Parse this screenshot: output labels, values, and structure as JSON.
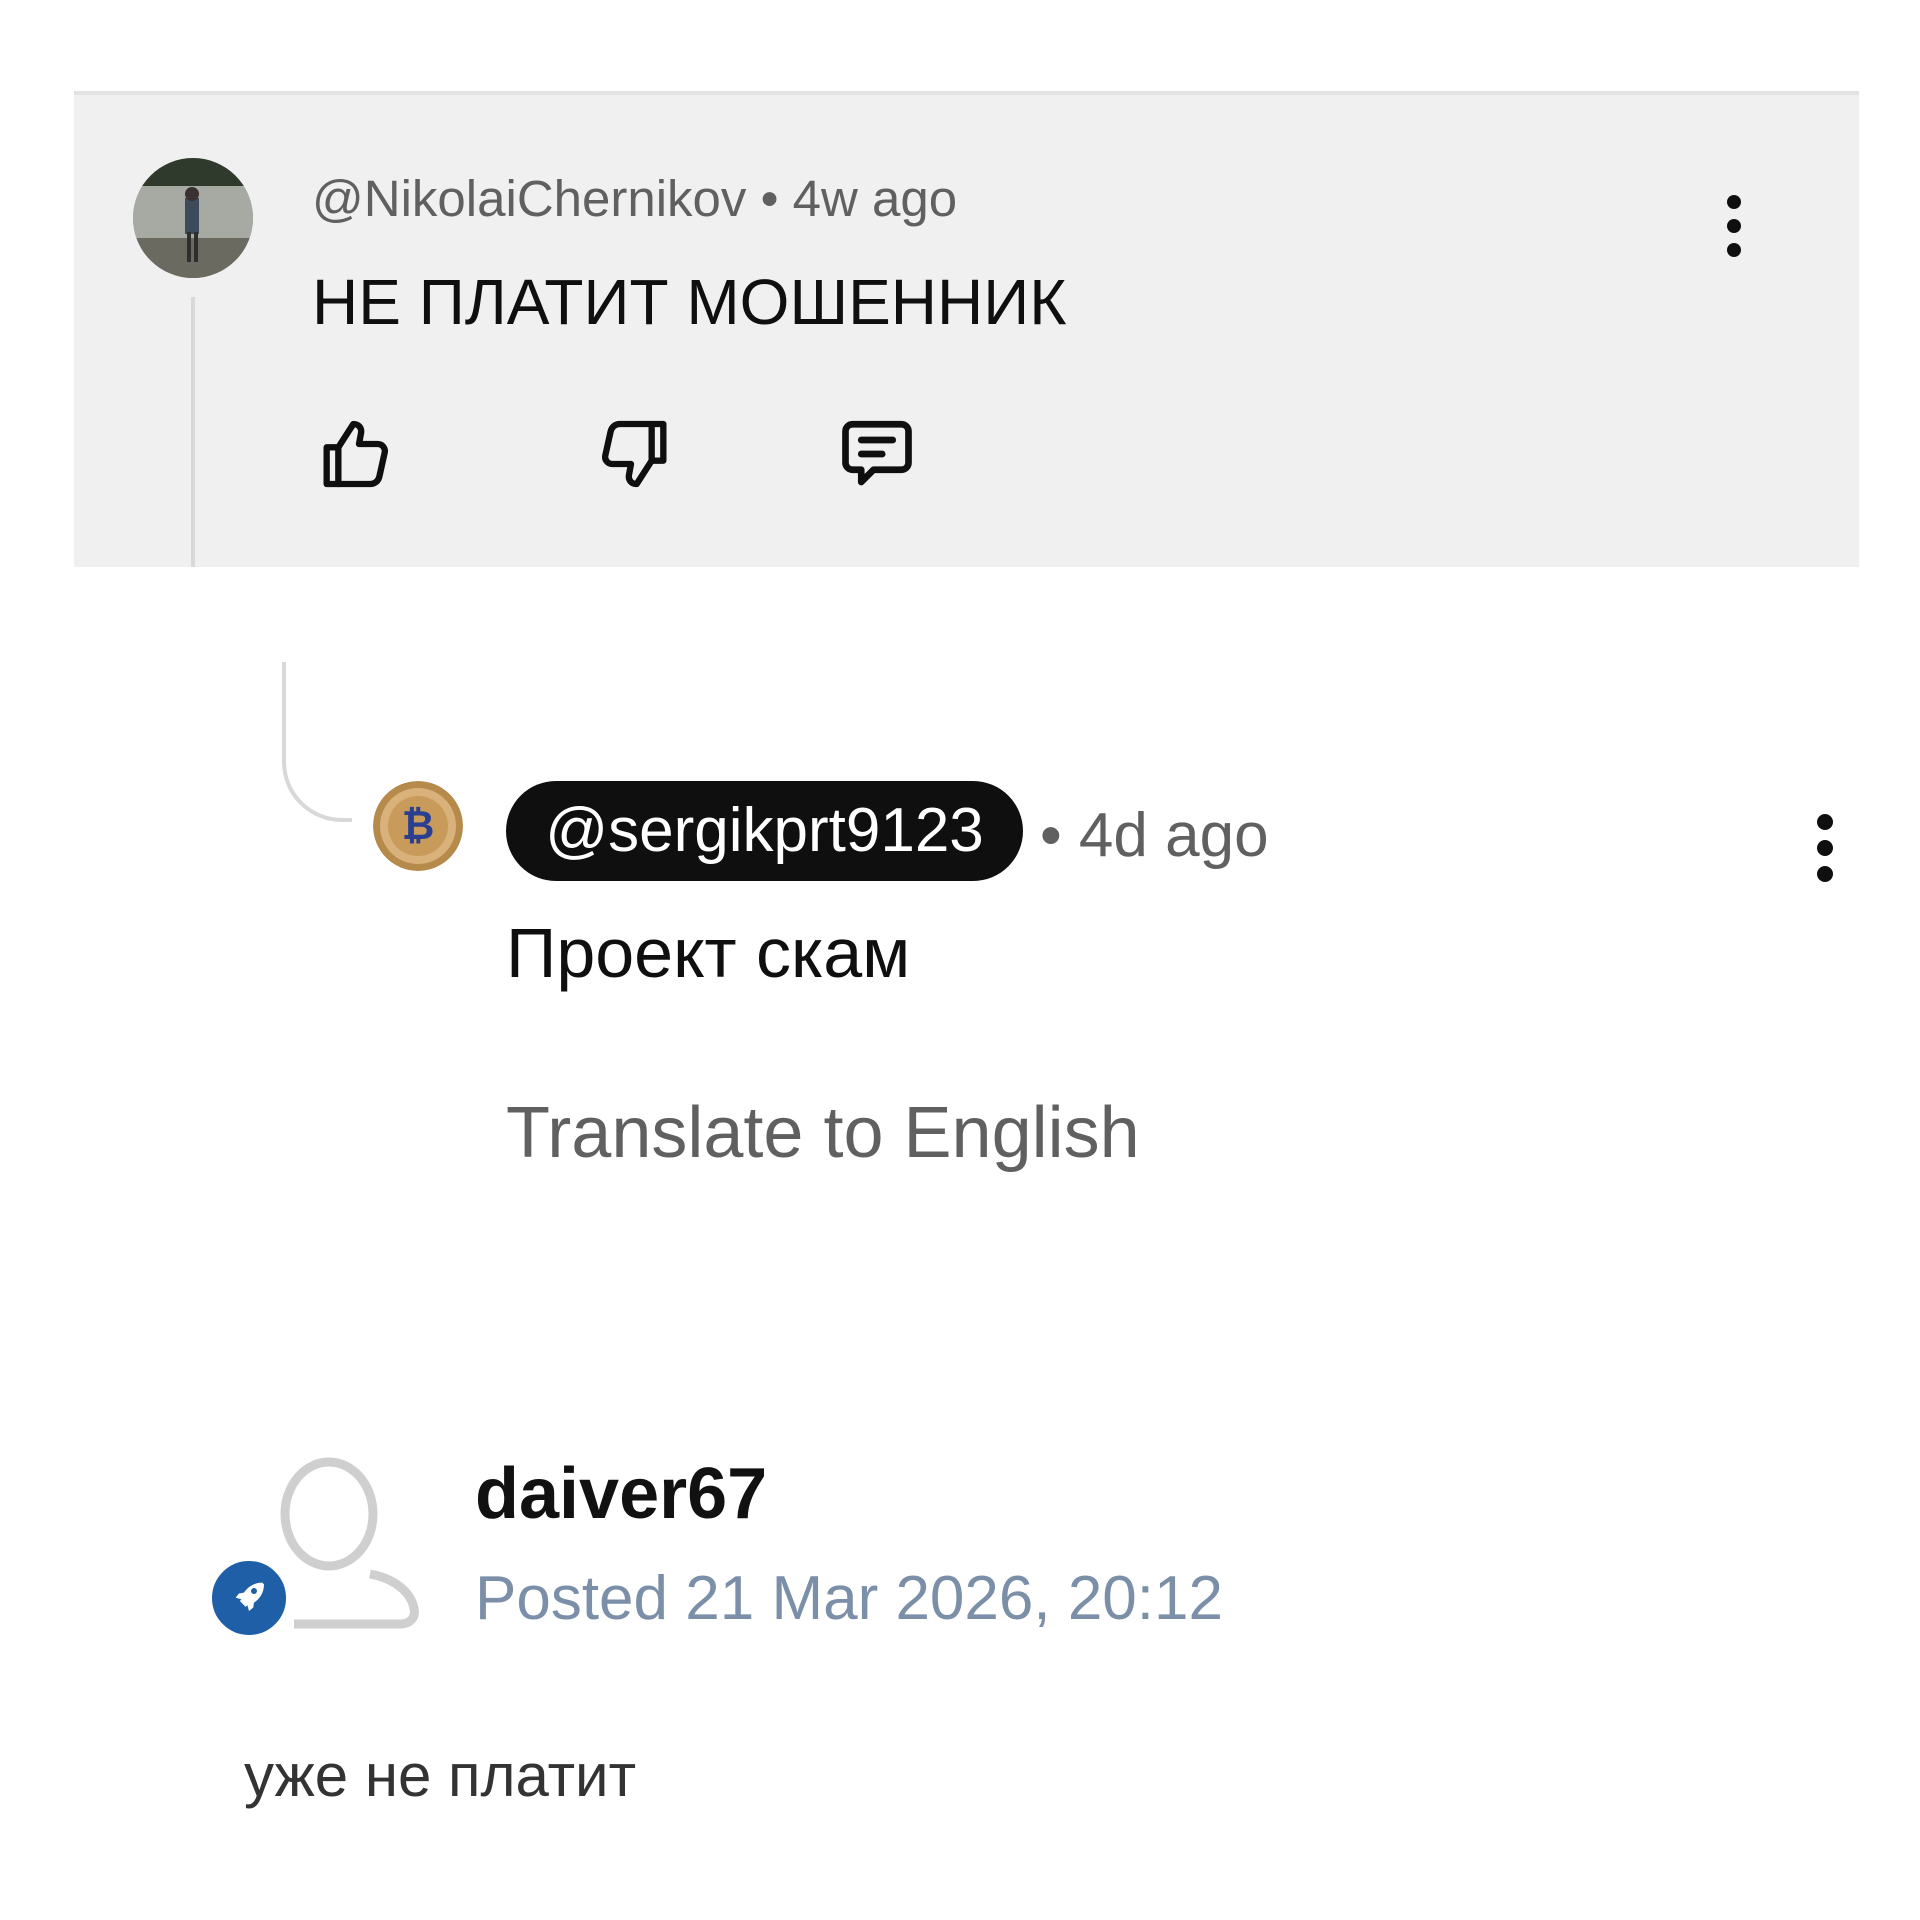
{
  "comment": {
    "author": "@NikolaiChernikov",
    "separator": " • ",
    "time": "4w ago",
    "text": "НЕ ПЛАТИТ МОШЕННИК",
    "actions": {
      "like_icon": "thumbs-up-icon",
      "dislike_icon": "thumbs-down-icon",
      "reply_icon": "reply-comment-icon"
    },
    "more_icon": "more-vertical-icon"
  },
  "reply": {
    "author": "@sergikprt9123",
    "time": "• 4d ago",
    "text": "Проект скам",
    "translate_label": "Translate to English",
    "more_icon": "more-vertical-icon",
    "avatar_icon": "bitcoin-coin-icon"
  },
  "post": {
    "author": "daiver67",
    "date": "Posted 21 Mar 2026, 20:12",
    "body": "уже не платит",
    "avatar_icon": "default-user-icon",
    "badge_icon": "rocket-icon",
    "badge_color": "#1f5fa8"
  },
  "colors": {
    "highlight_bg": "#f0f0f0",
    "secondary_text": "#606060",
    "date_text": "#7b8fa8",
    "pill_bg": "#0f0f0f"
  }
}
